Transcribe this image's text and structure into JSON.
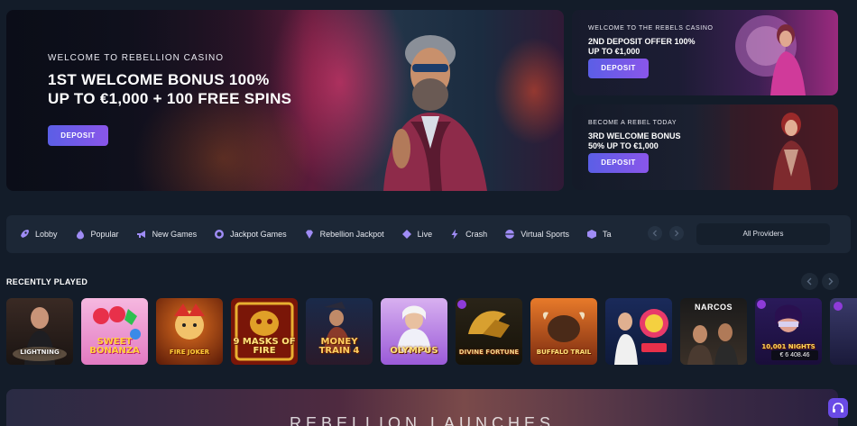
{
  "hero": {
    "eyebrow": "WELCOME TO REBELLION CASINO",
    "title_line1": "1ST WELCOME BONUS 100%",
    "title_line2": "UP TO €1,000 + 100 FREE SPINS",
    "button": "DEPOSIT"
  },
  "promos": [
    {
      "eyebrow": "WELCOME TO THE REBELS CASINO",
      "title_line1": "2ND DEPOSIT OFFER 100%",
      "title_line2": "UP TO €1,000",
      "button": "DEPOSIT"
    },
    {
      "eyebrow": "BECOME A REBEL TODAY",
      "title_line1": "3RD WELCOME BONUS",
      "title_line2": "50% UP TO €1,000",
      "button": "DEPOSIT"
    }
  ],
  "nav": {
    "items": [
      {
        "label": "Lobby",
        "icon": "rocket-icon"
      },
      {
        "label": "Popular",
        "icon": "flame-icon"
      },
      {
        "label": "New Games",
        "icon": "megaphone-icon"
      },
      {
        "label": "Jackpot Games",
        "icon": "chip-icon"
      },
      {
        "label": "Rebellion Jackpot",
        "icon": "gem-icon"
      },
      {
        "label": "Live",
        "icon": "diamond-icon"
      },
      {
        "label": "Crash",
        "icon": "lightning-icon"
      },
      {
        "label": "Virtual Sports",
        "icon": "ball-icon"
      },
      {
        "label": "Ta",
        "icon": "cube-icon"
      }
    ],
    "providers": "All Providers"
  },
  "recently_played": {
    "title": "RECENTLY PLAYED",
    "games": [
      {
        "name": "Lightning",
        "icon": "lightning-roulette-tile"
      },
      {
        "name": "Sweet Bonanza",
        "icon": "sweet-bonanza-tile"
      },
      {
        "name": "Fire Joker",
        "icon": "fire-joker-tile"
      },
      {
        "name": "9 Masks of Fire",
        "icon": "masks-of-fire-tile"
      },
      {
        "name": "Money Train 4",
        "icon": "money-train-tile"
      },
      {
        "name": "Olympus",
        "icon": "gates-of-olympus-tile"
      },
      {
        "name": "Divine Fortune",
        "icon": "divine-fortune-tile"
      },
      {
        "name": "Buffalo Trail",
        "icon": "buffalo-trail-tile"
      },
      {
        "name": "",
        "icon": "live-dealer-tile"
      },
      {
        "name": "",
        "icon": "crazy-time-tile"
      },
      {
        "name": "NARCOS",
        "icon": "narcos-tile"
      },
      {
        "name": "10,001 Nights",
        "amount": "€ 6 408.46",
        "icon": "nights-tile"
      },
      {
        "name": "",
        "icon": "partial-tile"
      }
    ]
  },
  "bottom_banner": {
    "title": "REBELLION LAUNCHES"
  },
  "colors": {
    "background": "#131c29",
    "accent": "#6a5ae8",
    "nav_bg": "#1c2736"
  }
}
